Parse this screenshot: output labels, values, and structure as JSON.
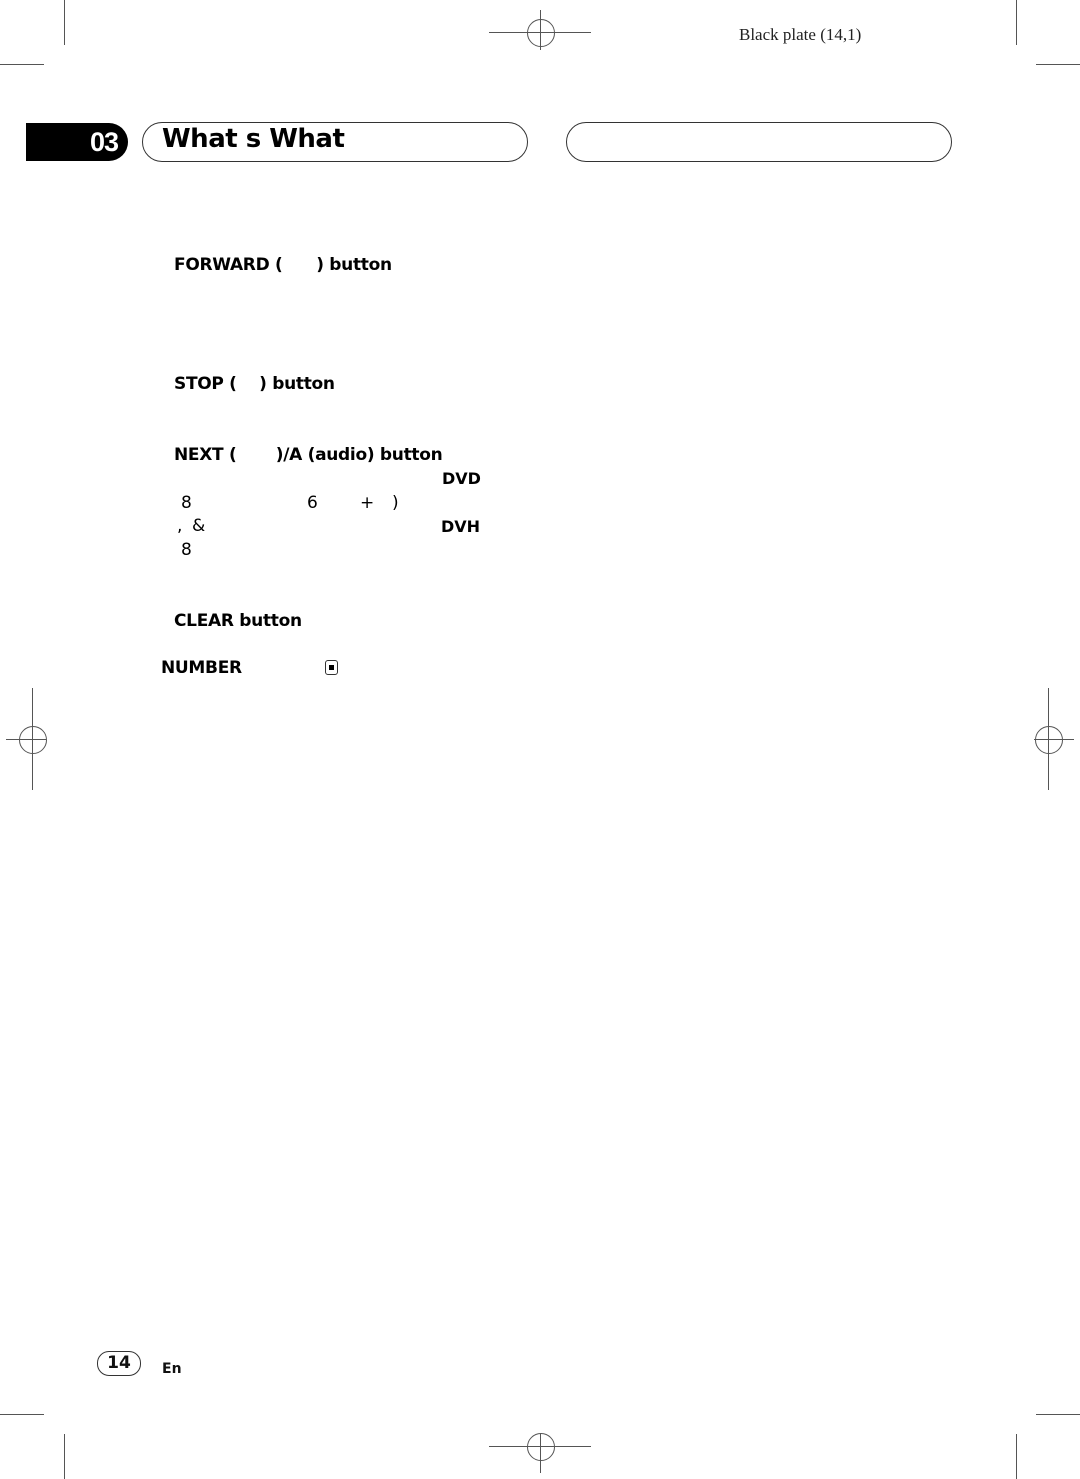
{
  "header": {
    "plate_label": "Black plate (14,1)",
    "chapter_number": "03",
    "chapter_title": "What s What",
    "right_title": ""
  },
  "sections": [
    {
      "heading": "FORWARD (      ) button"
    },
    {
      "heading": "STOP (    ) button"
    },
    {
      "heading": "NEXT (       )/A (audio) button"
    },
    {
      "heading": "CLEAR button"
    }
  ],
  "next_section_detail": {
    "model_1": "DVD",
    "model_2": "DVH",
    "row1": [
      "8",
      "6",
      "+",
      ")"
    ],
    "row2": [
      ",",
      "&"
    ],
    "row3": [
      "8"
    ]
  },
  "number_label": "NUMBER",
  "icons": {
    "stop_icon": "stop-square-icon"
  },
  "footer": {
    "page_number": "14",
    "language": "En"
  }
}
